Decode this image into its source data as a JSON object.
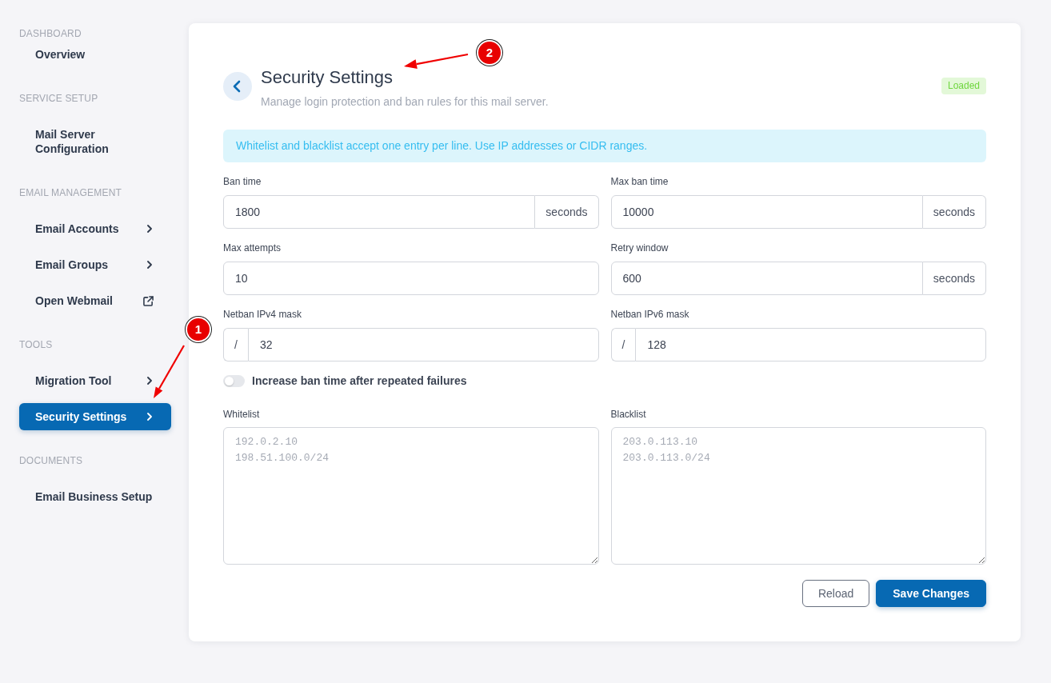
{
  "sidebar": {
    "sections": [
      {
        "heading": "DASHBOARD",
        "items": [
          {
            "label": "Overview",
            "selected": false,
            "kind": "plain"
          }
        ]
      },
      {
        "heading": "SERVICE SETUP",
        "items": [
          {
            "label": "Mail Server Configuration",
            "selected": false,
            "kind": "plain"
          }
        ]
      },
      {
        "heading": "EMAIL MANAGEMENT",
        "items": [
          {
            "label": "Email Accounts",
            "selected": false,
            "kind": "chevron"
          },
          {
            "label": "Email Groups",
            "selected": false,
            "kind": "chevron"
          },
          {
            "label": "Open Webmail",
            "selected": false,
            "kind": "external-link"
          }
        ]
      },
      {
        "heading": "TOOLS",
        "items": [
          {
            "label": "Migration Tool",
            "selected": false,
            "kind": "chevron"
          },
          {
            "label": "Security Settings",
            "selected": true,
            "kind": "chevron",
            "annotation": "1"
          }
        ]
      },
      {
        "heading": "DOCUMENTS",
        "items": [
          {
            "label": "Email Business Setup",
            "selected": false,
            "kind": "plain"
          }
        ]
      }
    ]
  },
  "header": {
    "title": "Security Settings",
    "subtitle": "Manage login protection and ban rules for this mail server.",
    "status_badge": "Loaded",
    "annotation": "2"
  },
  "alert": {
    "text": "Whitelist and blacklist accept one entry per line. Use IP addresses or CIDR ranges."
  },
  "fields": [
    {
      "label": "Ban time",
      "value": "1800",
      "suffix": "seconds"
    },
    {
      "label": "Max ban time",
      "value": "10000",
      "suffix": "seconds"
    },
    {
      "label": "Max attempts",
      "value": "10"
    },
    {
      "label": "Retry window",
      "value": "600",
      "suffix": "seconds"
    },
    {
      "label": "Netban IPv4 mask",
      "prefix": "/",
      "value": "32"
    },
    {
      "label": "Netban IPv6 mask",
      "prefix": "/",
      "value": "128"
    }
  ],
  "toggle": {
    "label": "Increase ban time after repeated failures",
    "on": false
  },
  "lists": [
    {
      "label": "Whitelist",
      "placeholder": "192.0.2.10\n198.51.100.0/24"
    },
    {
      "label": "Blacklist",
      "placeholder": "203.0.113.10\n203.0.113.0/24"
    }
  ],
  "buttons": [
    {
      "label": "Reload",
      "kind": "secondary"
    },
    {
      "label": "Save Changes",
      "kind": "primary"
    }
  ]
}
